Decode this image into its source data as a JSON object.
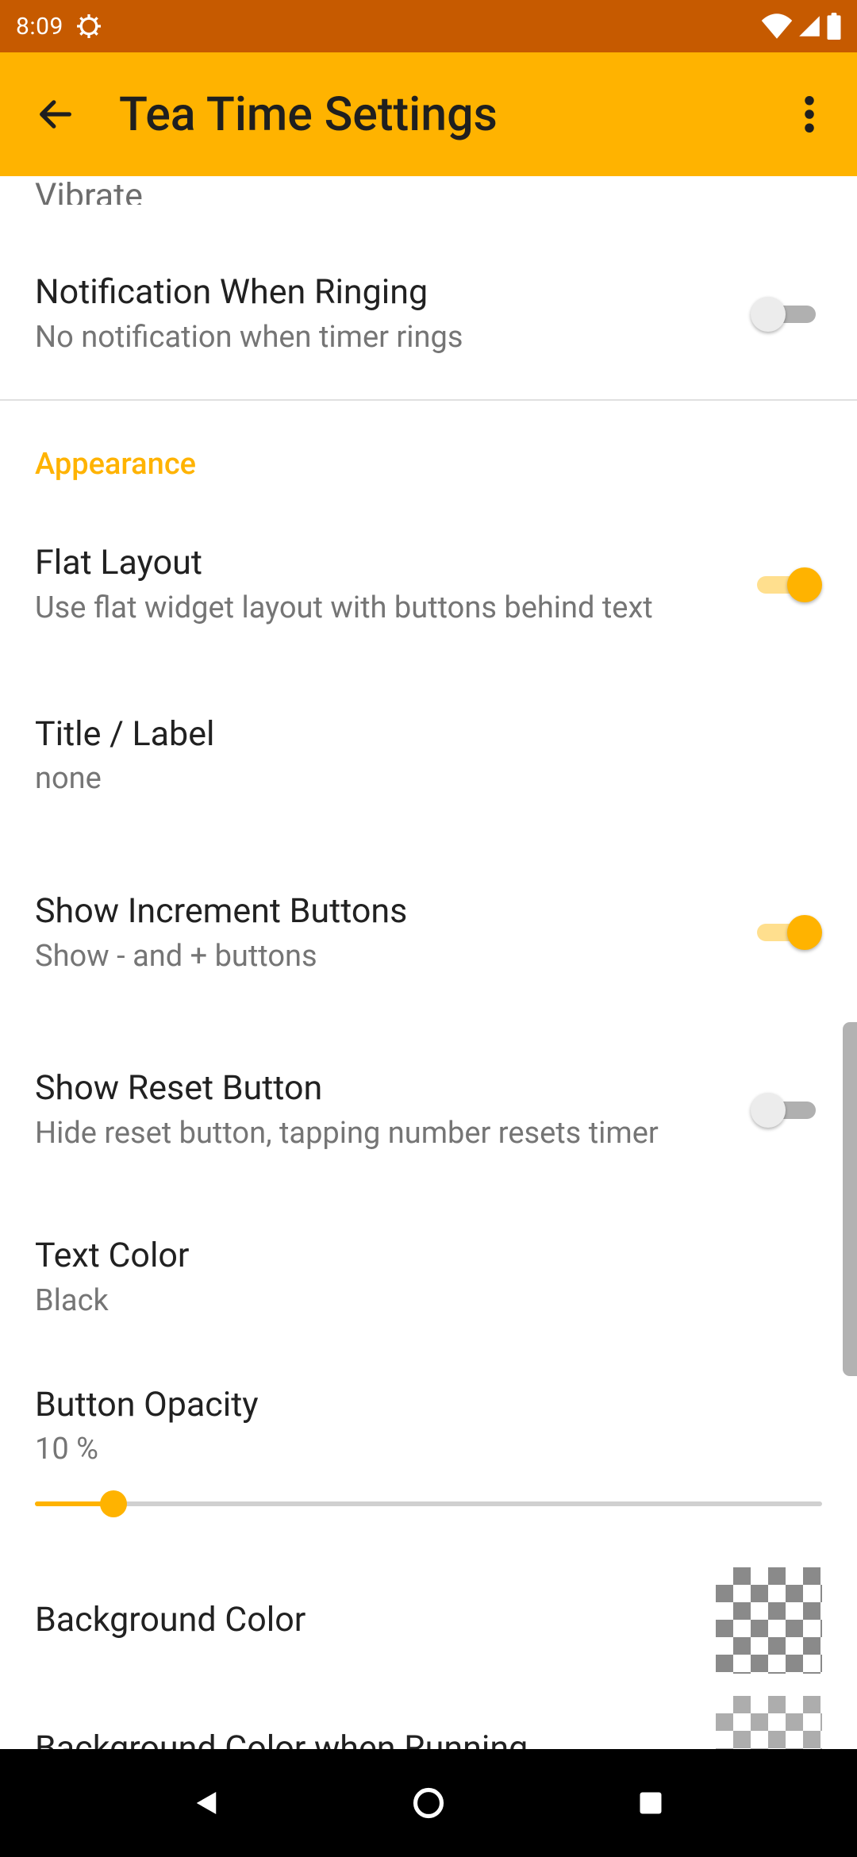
{
  "status": {
    "time": "8:09"
  },
  "app_bar": {
    "title": "Tea Time Settings"
  },
  "cut_row": {
    "label": "Vibrate"
  },
  "settings": {
    "notification": {
      "title": "Notification When Ringing",
      "subtitle": "No notification when timer rings",
      "enabled": false
    },
    "section_appearance": "Appearance",
    "flat_layout": {
      "title": "Flat Layout",
      "subtitle": "Use flat widget layout with buttons behind text",
      "enabled": true
    },
    "title_label": {
      "title": "Title / Label",
      "subtitle": "none"
    },
    "increment": {
      "title": "Show Increment Buttons",
      "subtitle": "Show - and + buttons",
      "enabled": true
    },
    "reset": {
      "title": "Show Reset Button",
      "subtitle": "Hide reset button, tapping number resets timer",
      "enabled": false
    },
    "text_color": {
      "title": "Text Color",
      "subtitle": "Black"
    },
    "opacity": {
      "title": "Button Opacity",
      "subtitle": "10 %",
      "percent": 10
    },
    "bg_color": {
      "title": "Background Color"
    },
    "bg_color_running": {
      "title": "Background Color when Running"
    }
  },
  "colors": {
    "status_bar": "#c65a00",
    "app_bar": "#ffb300",
    "accent": "#ffb300"
  }
}
